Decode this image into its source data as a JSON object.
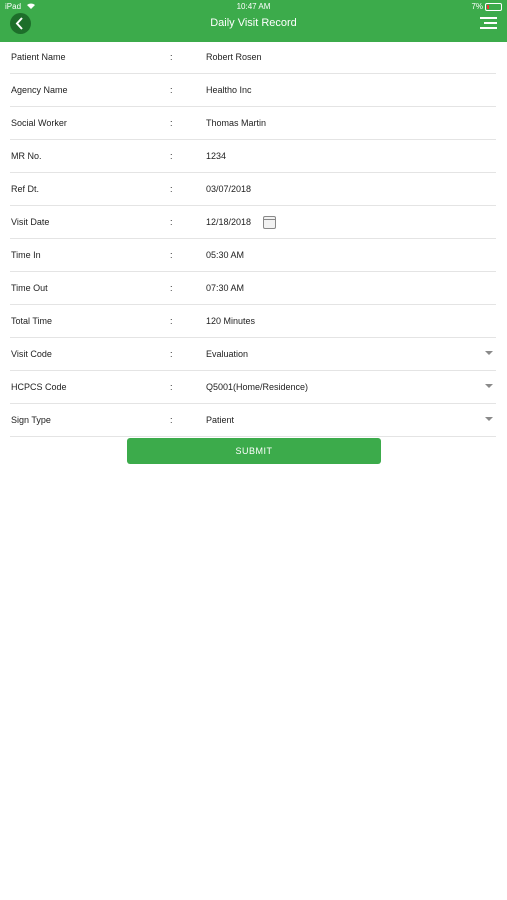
{
  "status_bar": {
    "carrier": "iPad",
    "time": "10:47 AM",
    "battery": "7%"
  },
  "header": {
    "title": "Daily Visit Record"
  },
  "form": {
    "separator": ":",
    "rows": [
      {
        "label": "Patient Name",
        "value": "Robert Rosen"
      },
      {
        "label": "Agency Name",
        "value": "Healtho Inc"
      },
      {
        "label": "Social Worker",
        "value": "Thomas Martin"
      },
      {
        "label": "MR No.",
        "value": "1234"
      },
      {
        "label": "Ref Dt.",
        "value": "03/07/2018"
      },
      {
        "label": "Visit Date",
        "value": "12/18/2018"
      },
      {
        "label": "Time In",
        "value": "05:30 AM"
      },
      {
        "label": "Time Out",
        "value": "07:30 AM"
      },
      {
        "label": "Total Time",
        "value": "120 Minutes"
      },
      {
        "label": "Visit Code",
        "value": "Evaluation"
      },
      {
        "label": "HCPCS Code",
        "value": "Q5001(Home/Residence)"
      },
      {
        "label": "Sign Type",
        "value": "Patient"
      }
    ]
  },
  "submit_label": "SUBMIT",
  "icons": {
    "back": "back-arrow-icon",
    "menu": "hamburger-menu-icon",
    "calendar": "calendar-icon",
    "dropdown": "chevron-down-icon",
    "wifi": "wifi-icon",
    "battery": "battery-icon"
  },
  "colors": {
    "accent": "#3cab4b",
    "back_button": "#1d6e2a",
    "divider": "#e4e4e4"
  }
}
